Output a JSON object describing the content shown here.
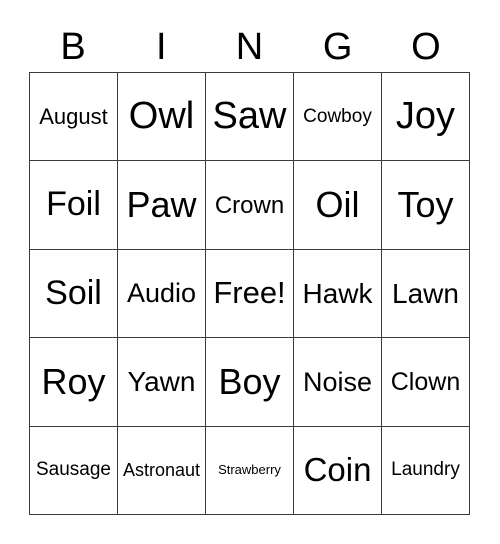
{
  "card": {
    "header": {
      "letters": [
        "B",
        "I",
        "N",
        "G",
        "O"
      ]
    },
    "grid": {
      "rows": 5,
      "columns": 5,
      "border_color": "#3a3a3a",
      "background_color": "#ffffff",
      "text_color": "#000000",
      "cells": [
        [
          {
            "label": "August",
            "font_size": "22px"
          },
          {
            "label": "Owl",
            "font_size": "38px"
          },
          {
            "label": "Saw",
            "font_size": "38px"
          },
          {
            "label": "Cowboy",
            "font_size": "19px"
          },
          {
            "label": "Joy",
            "font_size": "38px"
          }
        ],
        [
          {
            "label": "Foil",
            "font_size": "34px"
          },
          {
            "label": "Paw",
            "font_size": "36px"
          },
          {
            "label": "Crown",
            "font_size": "24px"
          },
          {
            "label": "Oil",
            "font_size": "36px"
          },
          {
            "label": "Toy",
            "font_size": "36px"
          }
        ],
        [
          {
            "label": "Soil",
            "font_size": "34px"
          },
          {
            "label": "Audio",
            "font_size": "27px"
          },
          {
            "label": "Free!",
            "font_size": "31px"
          },
          {
            "label": "Hawk",
            "font_size": "28px"
          },
          {
            "label": "Lawn",
            "font_size": "28px"
          }
        ],
        [
          {
            "label": "Roy",
            "font_size": "36px"
          },
          {
            "label": "Yawn",
            "font_size": "28px"
          },
          {
            "label": "Boy",
            "font_size": "36px"
          },
          {
            "label": "Noise",
            "font_size": "27px"
          },
          {
            "label": "Clown",
            "font_size": "25px"
          }
        ],
        [
          {
            "label": "Sausage",
            "font_size": "19px"
          },
          {
            "label": "Astronaut",
            "font_size": "18px"
          },
          {
            "label": "Strawberry",
            "font_size": "13px"
          },
          {
            "label": "Coin",
            "font_size": "33px"
          },
          {
            "label": "Laundry",
            "font_size": "19px"
          }
        ]
      ]
    }
  }
}
